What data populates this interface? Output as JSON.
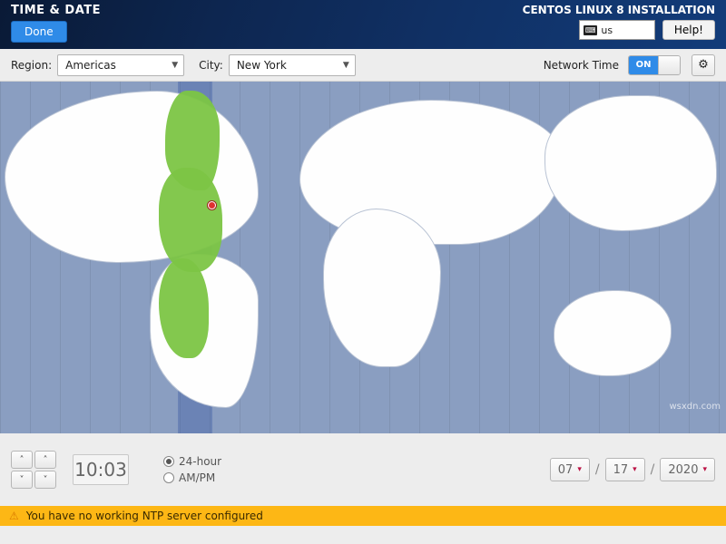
{
  "banner": {
    "title": "TIME & DATE",
    "done_label": "Done",
    "install_title": "CENTOS LINUX 8 INSTALLATION",
    "keyboard_layout": "us",
    "help_label": "Help!"
  },
  "toolbar": {
    "region_label": "Region:",
    "region_value": "Americas",
    "city_label": "City:",
    "city_value": "New York",
    "network_time_label": "Network Time",
    "network_time_state": "ON"
  },
  "map": {
    "selected_city": "New York"
  },
  "time": {
    "hours": "10",
    "minutes": "03",
    "separator": ":",
    "format_24h_label": "24-hour",
    "format_ampm_label": "AM/PM",
    "selected_format": "24-hour"
  },
  "date": {
    "month": "07",
    "day": "17",
    "year": "2020"
  },
  "warning": {
    "message": "You have no working NTP server configured"
  },
  "watermark": "wsxdn.com"
}
